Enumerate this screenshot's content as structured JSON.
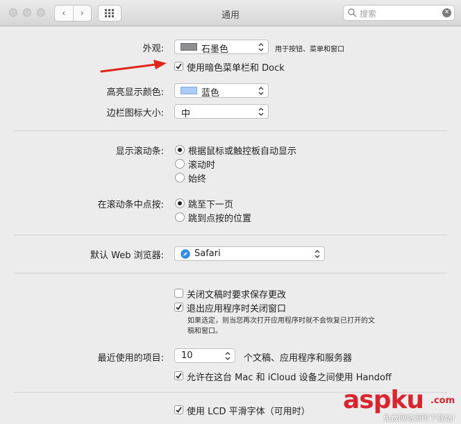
{
  "window": {
    "title": "通用"
  },
  "toolbar": {
    "search_placeholder": "搜索"
  },
  "appearance": {
    "label": "外观:",
    "value": "石墨色",
    "note": "用于按钮、菜单和窗口"
  },
  "dark_menu": {
    "label": "使用暗色菜单栏和 Dock",
    "checked": true
  },
  "highlight": {
    "label": "高亮显示颜色:",
    "value": "蓝色"
  },
  "sidebar_icon": {
    "label": "边栏图标大小:",
    "value": "中"
  },
  "scrollbars": {
    "label": "显示滚动条:",
    "options": [
      "根据鼠标或触控板自动显示",
      "滚动时",
      "始终"
    ],
    "selected": 0
  },
  "click_scrollbar": {
    "label": "在滚动条中点按:",
    "options": [
      "跳至下一页",
      "跳到点按的位置"
    ],
    "selected": 0
  },
  "browser": {
    "label": "默认 Web 浏览器:",
    "value": "Safari"
  },
  "ask_save": {
    "label": "关闭文稿时要求保存更改",
    "checked": false
  },
  "close_windows": {
    "label": "退出应用程序时关闭窗口",
    "checked": true,
    "hint_line1": "如果选定，则当您再次打开应用程序时就不会恢复已打开的文",
    "hint_line2": "稿和窗口。"
  },
  "recent": {
    "label": "最近使用的项目:",
    "value": "10",
    "suffix": "个文稿、应用程序和服务器"
  },
  "handoff": {
    "label": "允许在这台 Mac 和 iCloud 设备之间使用 Handoff",
    "checked": true
  },
  "lcd": {
    "label": "使用 LCD 平滑字体（可用时）",
    "checked": true
  },
  "watermark": {
    "brand": "aspku",
    "suffix": ".com",
    "tagline": "免费网站源码下载站!"
  },
  "colors": {
    "graphite": "#8e8e93",
    "blue_highlight": "#a9cdf7",
    "arrow": "#e0261b",
    "watermark_red": "#d9262e"
  }
}
